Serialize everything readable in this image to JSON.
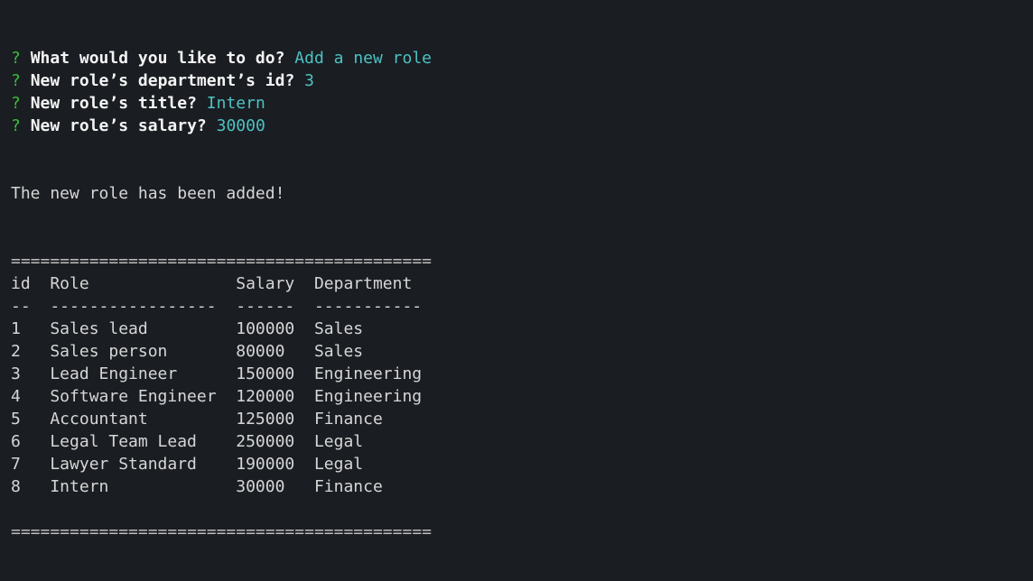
{
  "prompts": [
    {
      "question": "What would you like to do?",
      "answer": "Add a new role"
    },
    {
      "question": "New role’s department’s id?",
      "answer": "3"
    },
    {
      "question": "New role’s title?",
      "answer": "Intern"
    },
    {
      "question": "New role’s salary?",
      "answer": "30000"
    }
  ],
  "prompt_marker": "?",
  "message": "The new role has been added!",
  "separator": "===========================================",
  "table": {
    "headers": [
      "id",
      "Role",
      "Salary",
      "Department"
    ],
    "underlines": [
      "--",
      "-----------------",
      "------",
      "-----------"
    ],
    "rows": [
      [
        "1",
        "Sales lead",
        "100000",
        "Sales"
      ],
      [
        "2",
        "Sales person",
        "80000",
        "Sales"
      ],
      [
        "3",
        "Lead Engineer",
        "150000",
        "Engineering"
      ],
      [
        "4",
        "Software Engineer",
        "120000",
        "Engineering"
      ],
      [
        "5",
        "Accountant",
        "125000",
        "Finance"
      ],
      [
        "6",
        "Legal Team Lead",
        "250000",
        "Legal"
      ],
      [
        "7",
        "Lawyer Standard",
        "190000",
        "Legal"
      ],
      [
        "8",
        "Intern",
        "30000",
        "Finance"
      ]
    ]
  },
  "colors": {
    "background": "#1a1d22",
    "marker": "#3cbf3c",
    "answer": "#4cc2c2",
    "text": "#d6d6d6"
  }
}
